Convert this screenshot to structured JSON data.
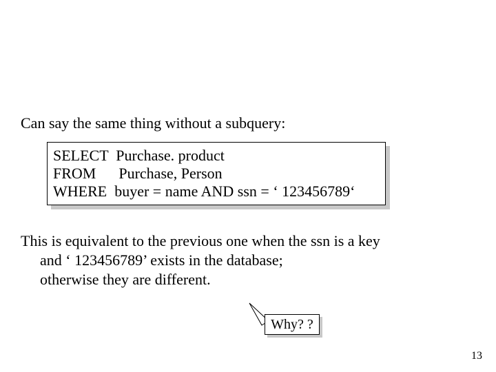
{
  "intro": "Can say the same thing without a subquery:",
  "code": {
    "line1": "SELECT  Purchase. product",
    "line2": "FROM      Purchase, Person",
    "line3": "WHERE  buyer = name AND ssn = ‘ 123456789‘"
  },
  "explain": {
    "line1": "This is equivalent to the previous one when the ssn is a key",
    "line2": "and ‘ 123456789’ exists in the database;",
    "line3": "otherwise they are different."
  },
  "callout": "Why? ?",
  "page_number": "13"
}
